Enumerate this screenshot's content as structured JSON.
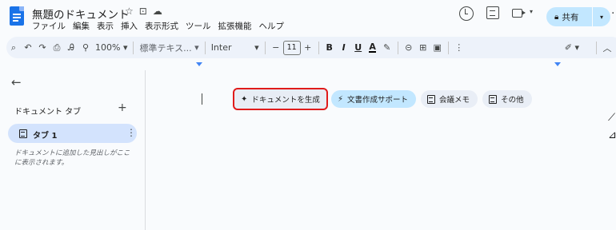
{
  "app": {
    "doc_title": "無題のドキュメント",
    "title_icons": [
      "star-icon",
      "folder-move-icon",
      "cloud-status-icon"
    ],
    "menu": [
      "ファイル",
      "編集",
      "表示",
      "挿入",
      "表示形式",
      "ツール",
      "拡張機能",
      "ヘルプ"
    ],
    "share_label": "共有"
  },
  "toolbar": {
    "zoom": "100%",
    "style": "標準テキス...",
    "font": "Inter",
    "font_size": "11",
    "minus": "−",
    "plus": "+"
  },
  "sidebar": {
    "heading": "ドキュメント タブ",
    "tab_label": "タブ 1",
    "outline_hint": "ドキュメントに追加した見出しがここに表示されます。"
  },
  "chips": {
    "generate": "ドキュメントを生成",
    "assist": "文書作成サポート",
    "meeting": "会議メモ",
    "more": "その他"
  },
  "colors": {
    "accent": "#1a73e8",
    "share_bg": "#c2e7ff",
    "highlight_outline": "#e01b1b"
  }
}
